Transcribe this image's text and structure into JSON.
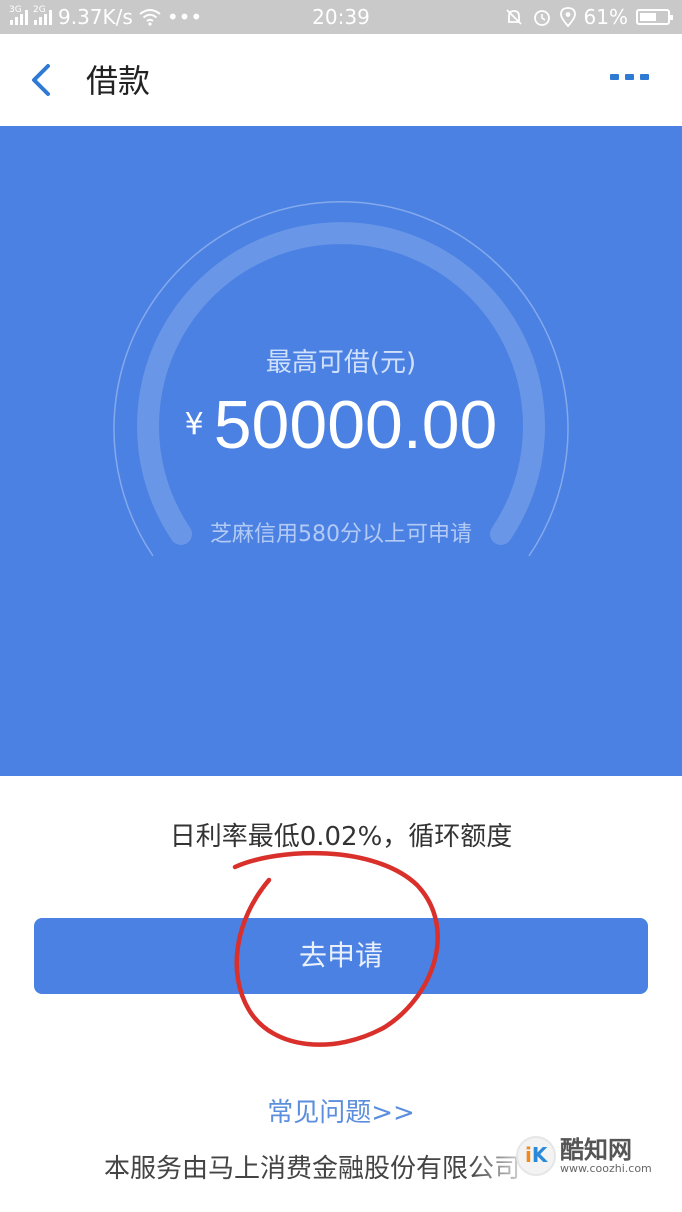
{
  "status_bar": {
    "net1": "3G",
    "net2": "2G",
    "speed": "9.37K/s",
    "dots": "•••",
    "time": "20:39",
    "battery": "61%",
    "battery_level": 0.61,
    "icons": [
      "signal-icon",
      "wifi-icon",
      "alarm-off-icon",
      "alarm-icon",
      "location-icon",
      "battery-icon"
    ]
  },
  "header": {
    "title": "借款",
    "back_icon": "back-chevron-icon",
    "more_icon": "more-icon",
    "accent": "#2f7ad3"
  },
  "hero": {
    "label": "最高可借(元)",
    "currency": "¥",
    "amount": "50000.00",
    "note": "芝麻信用580分以上可申请",
    "bg_color": "#4b81e3"
  },
  "main": {
    "rate_text": "日利率最低0.02%，循环额度",
    "apply_label": "去申请",
    "faq_label": "常见问题>>",
    "footer_text": "本服务由马上消费金融股份有限公司"
  },
  "watermark": {
    "logo_text": "K",
    "name": "酷知网",
    "url": "www.coozhi.com"
  }
}
